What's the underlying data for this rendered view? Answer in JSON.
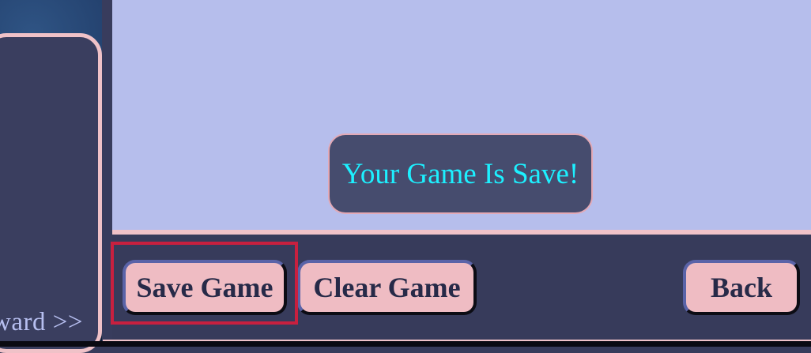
{
  "sidebar": {
    "forward_label": "ward >>"
  },
  "notification": {
    "message": "Your Game Is Save!"
  },
  "toolbar": {
    "save_label": "Save Game",
    "clear_label": "Clear Game",
    "back_label": "Back"
  },
  "colors": {
    "main_background": "#b6beec",
    "panel_dark": "#373b5b",
    "accent_pink": "#f0c2c8",
    "message_text": "#1df0ff",
    "button_fill": "#efbcc3",
    "focus_ring": "#c8203f"
  }
}
